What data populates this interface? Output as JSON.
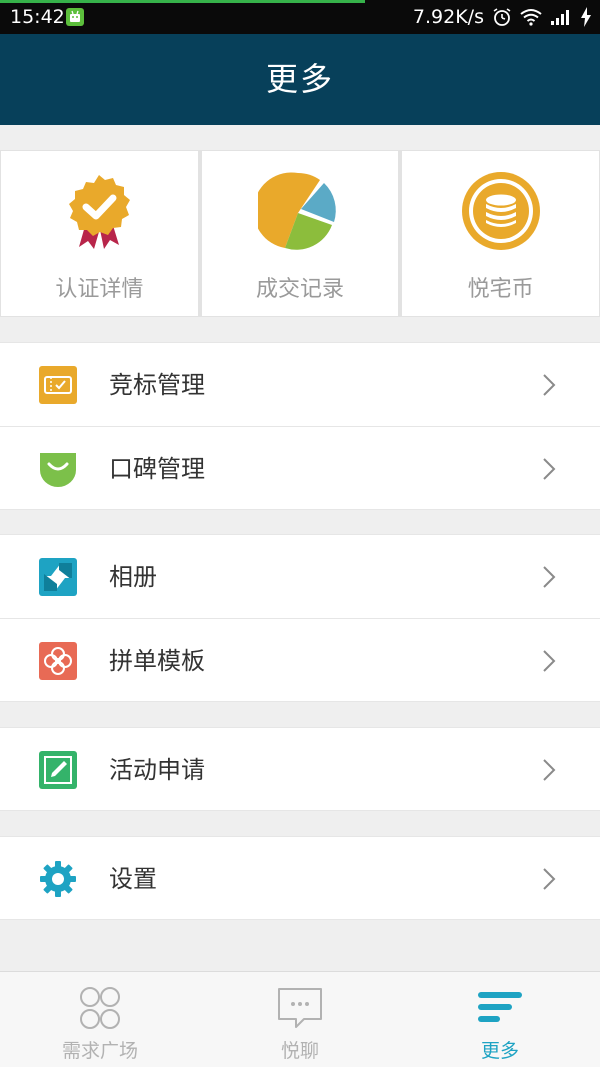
{
  "status_bar": {
    "time": "15:42",
    "speed": "7.92K/s"
  },
  "header": {
    "title": "更多"
  },
  "shortcuts": [
    {
      "label": "认证详情",
      "icon": "certification-badge-icon"
    },
    {
      "label": "成交记录",
      "icon": "pie-chart-icon"
    },
    {
      "label": "悦宅币",
      "icon": "coin-stack-icon"
    }
  ],
  "menu": {
    "bidding": "竞标管理",
    "reputation": "口碑管理",
    "album": "相册",
    "template": "拼单模板",
    "activity": "活动申请",
    "settings": "设置"
  },
  "bottom_nav": {
    "tabs": [
      {
        "label": "需求广场",
        "active": false
      },
      {
        "label": "悦聊",
        "active": false
      },
      {
        "label": "更多",
        "active": true
      }
    ]
  },
  "colors": {
    "header_bg": "#07405a",
    "accent": "#1ea3c3",
    "gold": "#e8a82c",
    "green": "#34b36a",
    "coral": "#e86a55"
  }
}
